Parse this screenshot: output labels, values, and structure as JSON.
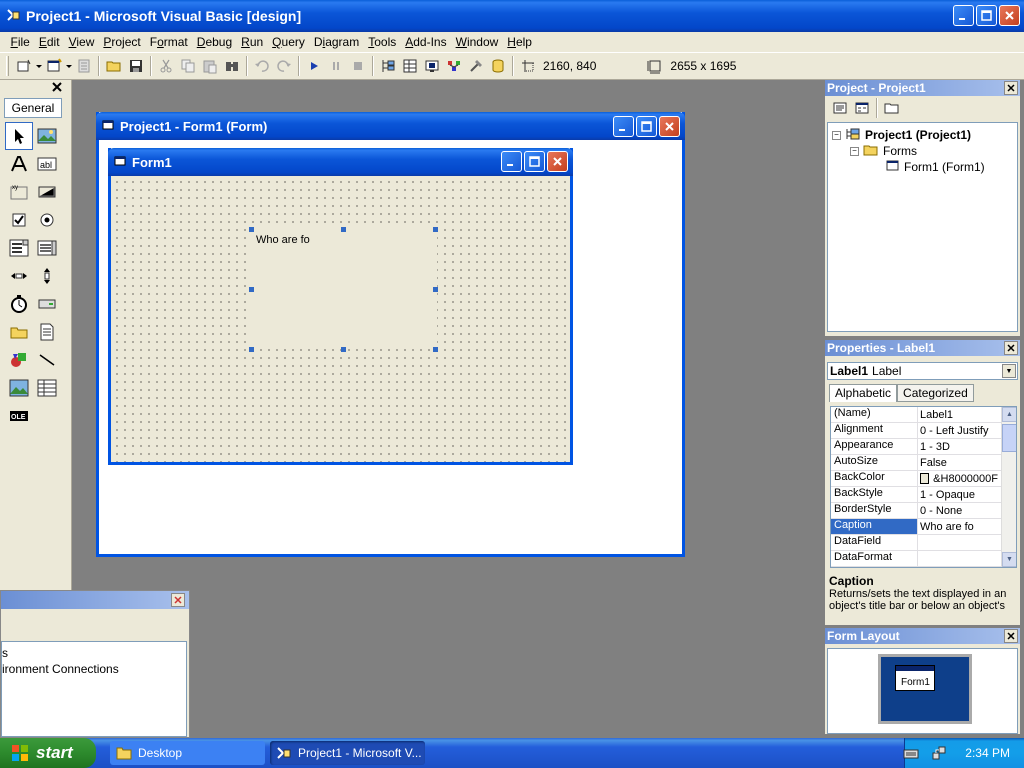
{
  "app": {
    "title": "Project1 - Microsoft Visual Basic [design]"
  },
  "menu": [
    "File",
    "Edit",
    "View",
    "Project",
    "Format",
    "Debug",
    "Run",
    "Query",
    "Diagram",
    "Tools",
    "Add-Ins",
    "Window",
    "Help"
  ],
  "menu_underline": [
    "F",
    "E",
    "V",
    "P",
    "o",
    "D",
    "R",
    "Q",
    "i",
    "T",
    "A",
    "W",
    "H"
  ],
  "toolbar": {
    "position_readout": "2160, 840",
    "size_readout": "2655 x 1695"
  },
  "toolbox": {
    "tab_label": "General",
    "tools": [
      "pointer-icon",
      "picturebox-icon",
      "label-icon",
      "textbox-icon",
      "frame-icon",
      "commandbutton-icon",
      "checkbox-icon",
      "optionbutton-icon",
      "combobox-icon",
      "listbox-icon",
      "hscrollbar-icon",
      "vscrollbar-icon",
      "timer-icon",
      "drivelistbox-icon",
      "dirlistbox-icon",
      "filelistbox-icon",
      "shape-icon",
      "line-icon",
      "image-icon",
      "data-icon",
      "ole-icon"
    ]
  },
  "designer": {
    "window_title": "Project1 - Form1 (Form)",
    "form_title": "Form1",
    "label_caption": "Who are fo"
  },
  "project_panel": {
    "title": "Project - Project1",
    "root": "Project1 (Project1)",
    "folder": "Forms",
    "item": "Form1 (Form1)"
  },
  "properties_panel": {
    "title": "Properties - Label1",
    "object_name": "Label1",
    "object_type": "Label",
    "tabs": [
      "Alphabetic",
      "Categorized"
    ],
    "rows": [
      {
        "name": "(Name)",
        "value": "Label1"
      },
      {
        "name": "Alignment",
        "value": "0 - Left Justify"
      },
      {
        "name": "Appearance",
        "value": "1 - 3D"
      },
      {
        "name": "AutoSize",
        "value": "False"
      },
      {
        "name": "BackColor",
        "value": "&H8000000F"
      },
      {
        "name": "BackStyle",
        "value": "1 - Opaque"
      },
      {
        "name": "BorderStyle",
        "value": "0 - None"
      },
      {
        "name": "Caption",
        "value": "Who are fo"
      },
      {
        "name": "DataField",
        "value": ""
      },
      {
        "name": "DataFormat",
        "value": ""
      }
    ],
    "desc_title": "Caption",
    "desc_text": "Returns/sets the text displayed in an object's title bar or below an object's"
  },
  "form_layout": {
    "title": "Form Layout",
    "mini_form_label": "Form1"
  },
  "data_env": {
    "items": [
      "s",
      "ironment Connections"
    ]
  },
  "taskbar": {
    "start_label": "start",
    "tasks": [
      "Desktop",
      "Project1 - Microsoft V..."
    ],
    "clock": "2:34 PM"
  },
  "colors": {
    "xp_blue": "#0054e3",
    "selection": "#316ac5",
    "face": "#ece9d8"
  }
}
